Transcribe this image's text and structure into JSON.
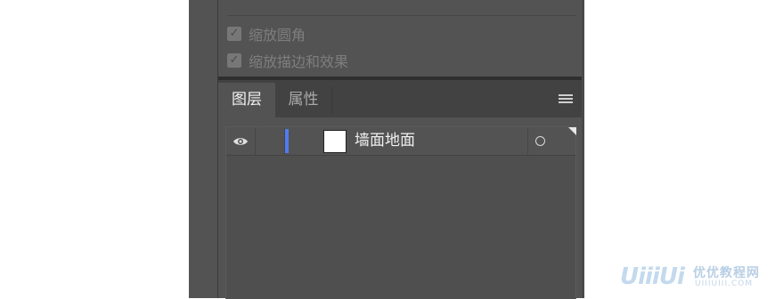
{
  "transform_panel": {
    "options": [
      {
        "label": "缩放圆角",
        "checked": true
      },
      {
        "label": "缩放描边和效果",
        "checked": true
      }
    ]
  },
  "layers_panel": {
    "tabs": [
      {
        "label": "图层",
        "active": true
      },
      {
        "label": "属性",
        "active": false
      }
    ],
    "menu_icon": "hamburger-menu-icon",
    "layers": [
      {
        "name": "墙面地面",
        "visible": true,
        "color": "#4f7cf0"
      }
    ]
  },
  "watermark": {
    "logo": "UiiiUi",
    "cn_text": "优优教程网",
    "en_text": "UIIIUIII.COM"
  }
}
